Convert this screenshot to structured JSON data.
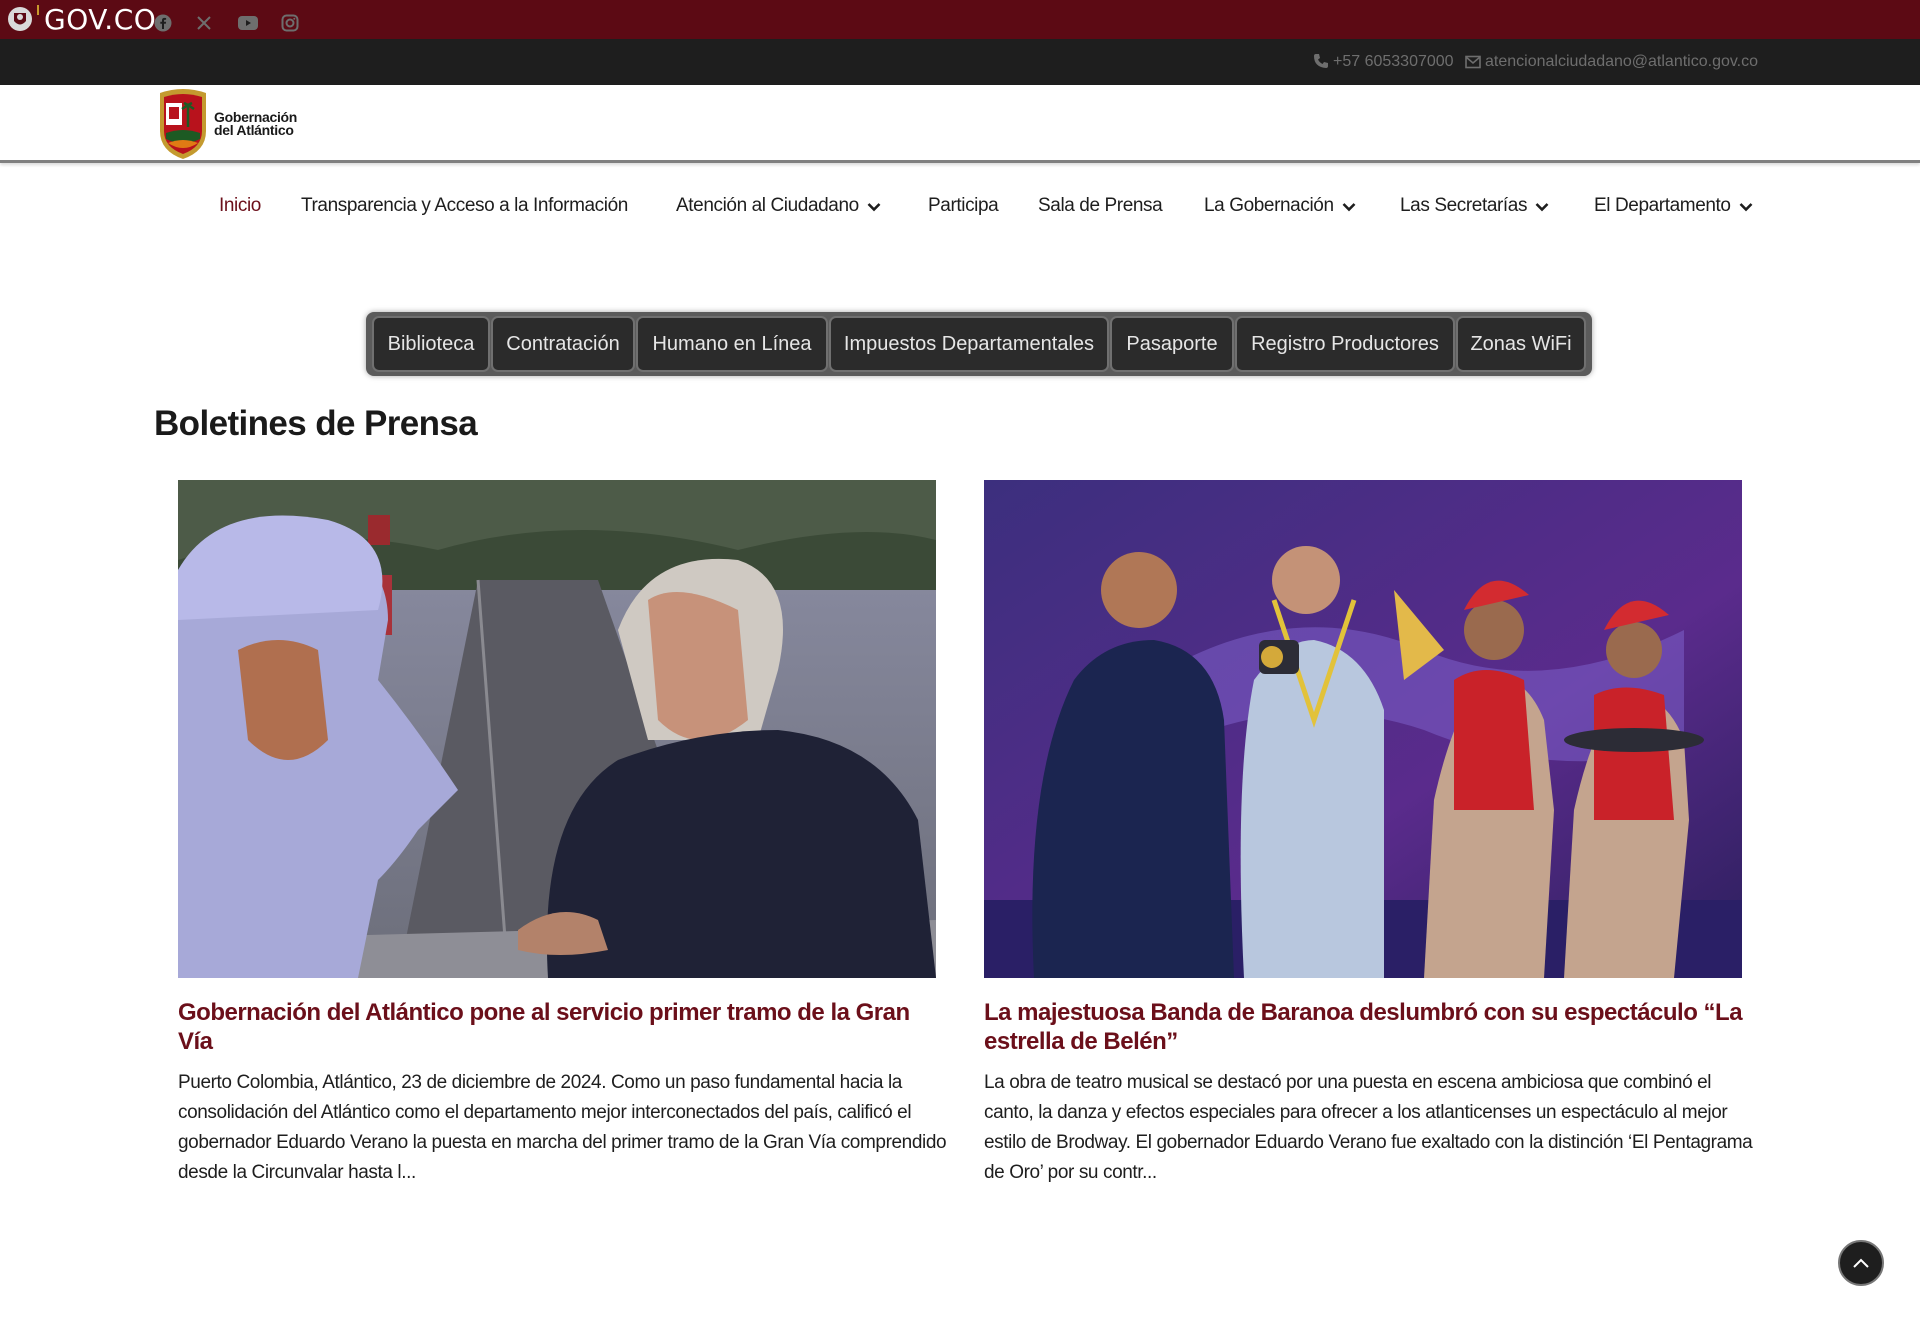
{
  "govbar": {
    "text": "GOV.CO"
  },
  "topbar": {
    "social": [
      "facebook-icon",
      "x-icon",
      "youtube-icon",
      "instagram-icon"
    ],
    "phone": "+57 6053307000",
    "email": "atencionalciudadano@atlantico.gov.co"
  },
  "header": {
    "brand_line1": "Gobernación",
    "brand_line2": "del Atlántico"
  },
  "nav": {
    "items": [
      {
        "label": "Inicio"
      },
      {
        "label": "Transparencia y Acceso a la Información"
      },
      {
        "label": "Atención al Ciudadano"
      },
      {
        "label": "Participa"
      },
      {
        "label": "Sala de Prensa"
      },
      {
        "label": "La Gobernación"
      },
      {
        "label": "Las Secretarías"
      },
      {
        "label": "El Departamento"
      }
    ]
  },
  "quicklinks": [
    "Biblioteca",
    "Contratación",
    "Humano en Línea",
    "Impuestos Departamentales",
    "Pasaporte",
    "Registro Productores",
    "Zonas WiFi"
  ],
  "section": {
    "title": "Boletines de Prensa"
  },
  "news": [
    {
      "title": "Gobernación del Atlántico pone al servicio primer tramo de la Gran Vía",
      "body": "Puerto Colombia, Atlántico, 23 de diciembre de 2024. Como un paso fundamental hacia la consolidación del Atlántico como el departamento mejor interconectados del país, calificó el gobernador Eduardo Verano la puesta en marcha del primer tramo de la Gran Vía comprendido desde la Circunvalar hasta l..."
    },
    {
      "title": "La majestuosa Banda de Baranoa deslumbró con su espectáculo “La estrella de Belén”",
      "body": "La obra de teatro musical se destacó por una puesta en escena ambiciosa que combinó el canto, la danza y efectos especiales para ofrecer a los atlanticenses un espectáculo al mejor estilo de Brodway. El gobernador Eduardo Verano fue exaltado con la distinción ‘El Pentagrama de Oro’ por su contr..."
    }
  ],
  "colors": {
    "govbar": "#5c0a14",
    "topbar": "#1e1e1e",
    "accent": "#6b0f1a",
    "quickbar": "#5b5b5b",
    "quick_button": "#2b2b2b"
  }
}
